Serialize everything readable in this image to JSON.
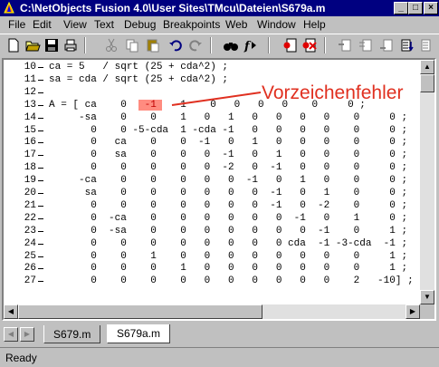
{
  "window": {
    "title": "C:\\NetObjects Fusion 4.0\\User Sites\\TMcu\\Dateien\\S679a.m",
    "minimize": "_",
    "maximize": "□",
    "close": "×"
  },
  "menu": [
    {
      "label": "File",
      "mnemonic": "F"
    },
    {
      "label": "Edit",
      "mnemonic": "E"
    },
    {
      "label": "View",
      "mnemonic": "V"
    },
    {
      "label": "Text",
      "mnemonic": "T"
    },
    {
      "label": "Debug",
      "mnemonic": "D"
    },
    {
      "label": "Breakpoints",
      "mnemonic": "B"
    },
    {
      "label": "Web",
      "mnemonic": "b"
    },
    {
      "label": "Window",
      "mnemonic": "W"
    },
    {
      "label": "Help",
      "mnemonic": "H"
    }
  ],
  "toolbar_icons": [
    "new-file-icon",
    "open-folder-icon",
    "save-icon",
    "print-icon",
    "cut-icon",
    "copy-icon",
    "paste-icon",
    "undo-icon",
    "redo-icon",
    "find-icon",
    "function-icon",
    "set-breakpoint-icon",
    "clear-breakpoint-icon",
    "step-in-icon",
    "step-over-icon",
    "step-out-icon",
    "continue-icon",
    "quit-debug-icon"
  ],
  "editor": {
    "lines": [
      {
        "num": "10",
        "pre": "ca = 5   / sqrt (25 + cda^2) ;",
        "hl": "",
        "post": ""
      },
      {
        "num": "11",
        "pre": "sa = cda / sqrt (25 + cda^2) ;",
        "hl": "",
        "post": ""
      },
      {
        "num": "12",
        "pre": "",
        "hl": "",
        "post": ""
      },
      {
        "num": "13",
        "pre": "A = [ ca    0  ",
        "hl": " -1 ",
        "post": "   1    0   0   0   0    0     0 ;"
      },
      {
        "num": "14",
        "pre": "     -sa    0    0    1   0   1   0   0   0   0    0     0 ;",
        "hl": "",
        "post": ""
      },
      {
        "num": "15",
        "pre": "       0    0 -5-cda  1 -cda -1   0   0   0   0    0     0 ;",
        "hl": "",
        "post": ""
      },
      {
        "num": "16",
        "pre": "       0   ca    0    0  -1   0   1   0   0   0    0     0 ;",
        "hl": "",
        "post": ""
      },
      {
        "num": "17",
        "pre": "       0   sa    0    0   0  -1   0   1   0   0    0     0 ;",
        "hl": "",
        "post": ""
      },
      {
        "num": "18",
        "pre": "       0    0    0    0   0  -2   0  -1   0   0    0     0 ;",
        "hl": "",
        "post": ""
      },
      {
        "num": "19",
        "pre": "     -ca    0    0    0   0   0  -1   0   1   0    0     0 ;",
        "hl": "",
        "post": ""
      },
      {
        "num": "20",
        "pre": "      sa    0    0    0   0   0   0  -1   0   1    0     0 ;",
        "hl": "",
        "post": ""
      },
      {
        "num": "21",
        "pre": "       0    0    0    0   0   0   0  -1   0  -2    0     0 ;",
        "hl": "",
        "post": ""
      },
      {
        "num": "22",
        "pre": "       0  -ca    0    0   0   0   0   0  -1   0    1     0 ;",
        "hl": "",
        "post": ""
      },
      {
        "num": "23",
        "pre": "       0  -sa    0    0   0   0   0   0   0  -1    0     1 ;",
        "hl": "",
        "post": ""
      },
      {
        "num": "24",
        "pre": "       0    0    0    0   0   0   0   0 cda  -1 -3-cda  -1 ;",
        "hl": "",
        "post": ""
      },
      {
        "num": "25",
        "pre": "       0    0    1    0   0   0   0   0   0   0    0     1 ;",
        "hl": "",
        "post": ""
      },
      {
        "num": "26",
        "pre": "       0    0    0    1   0   0   0   0   0   0    0     1 ;",
        "hl": "",
        "post": ""
      },
      {
        "num": "27",
        "pre": "       0    0    0    0   0   0   0   0   0   0    2   -10] ;",
        "hl": "",
        "post": ""
      }
    ],
    "annotation": "Vorzeichenfehler",
    "annotation_color": "#e03020",
    "highlight_color": "#ff8c80"
  },
  "tabs": [
    {
      "label": "S679.m",
      "active": false
    },
    {
      "label": "S679a.m",
      "active": true
    }
  ],
  "status": {
    "text": "Ready"
  }
}
